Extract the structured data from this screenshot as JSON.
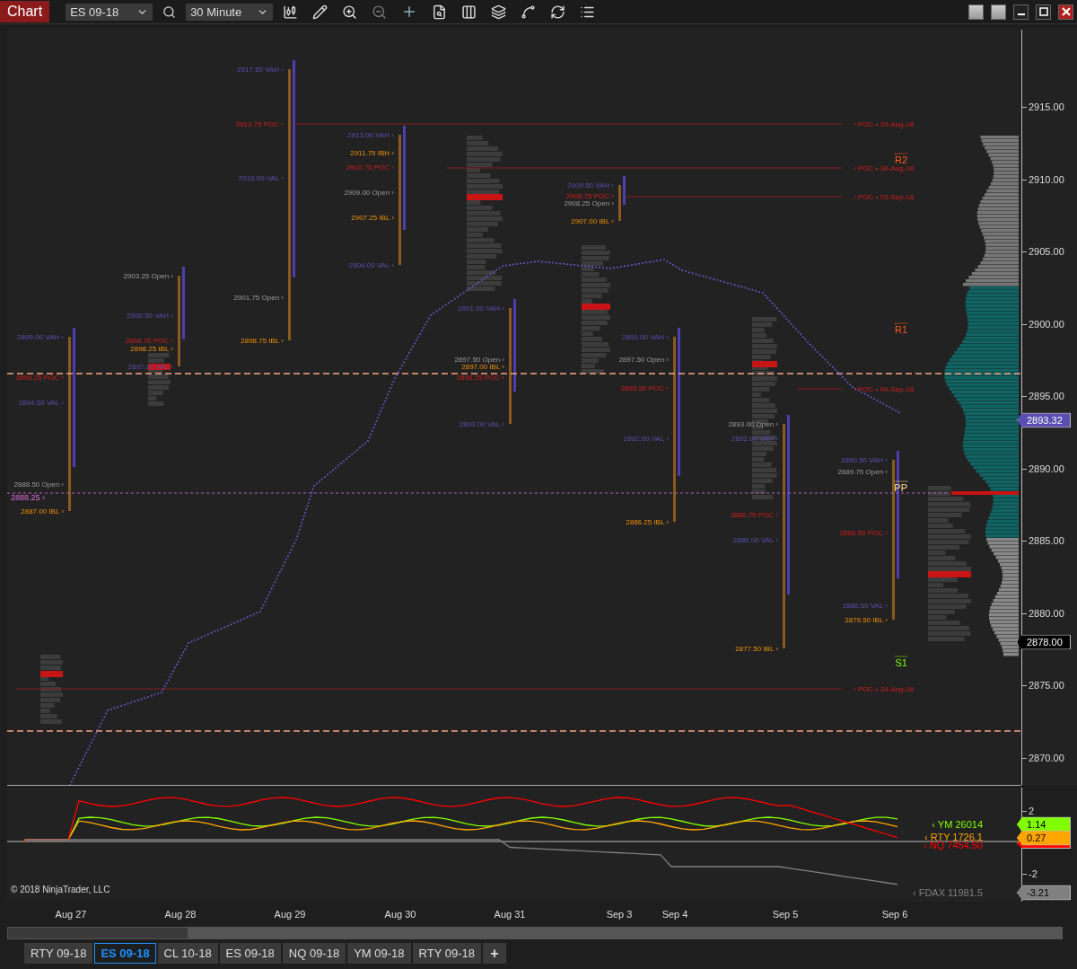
{
  "toolbar": {
    "title": "Chart",
    "instrument": "ES 09-18",
    "interval": "30 Minute"
  },
  "days": [
    {
      "date": "Aug 27",
      "levels": [
        {
          "text": "2899.00 VAH ›",
          "kind": "va"
        },
        {
          "text": "2896.25 POC ›",
          "kind": "poc"
        },
        {
          "text": "2894.50 VAL ›",
          "kind": "va"
        },
        {
          "text": "2888.50 Open ›",
          "kind": "open"
        },
        {
          "text": "2887.00 IBL ›",
          "kind": "ib"
        }
      ]
    },
    {
      "date": "Aug 28",
      "levels": [
        {
          "text": "2903.25 Open ›",
          "kind": "open"
        },
        {
          "text": "2900.50 VAH ›",
          "kind": "va"
        },
        {
          "text": "2898.75 POC ›",
          "kind": "poc"
        },
        {
          "text": "2898.25 IBL ›",
          "kind": "ib"
        },
        {
          "text": "2897.00 VAL ›",
          "kind": "va"
        }
      ]
    },
    {
      "date": "Aug 29",
      "levels": [
        {
          "text": "2917.50 VAH ›",
          "kind": "va"
        },
        {
          "text": "2913.75 POC ›",
          "kind": "poc"
        },
        {
          "text": "2910.00 VAL ›",
          "kind": "va"
        },
        {
          "text": "2901.75 Open ›",
          "kind": "open"
        },
        {
          "text": "2898.75 IBL ›",
          "kind": "ib"
        }
      ]
    },
    {
      "date": "Aug 30",
      "levels": [
        {
          "text": "2913.00 VAH ›",
          "kind": "va"
        },
        {
          "text": "2911.75 IBH ›",
          "kind": "ib"
        },
        {
          "text": "2910.75 POC ›",
          "kind": "poc"
        },
        {
          "text": "2909.00 Open ›",
          "kind": "open"
        },
        {
          "text": "2907.25 IBL ›",
          "kind": "ib"
        },
        {
          "text": "2904.00 VAL ›",
          "kind": "va"
        }
      ]
    },
    {
      "date": "Aug 31",
      "levels": [
        {
          "text": "2901.00 VAH ›",
          "kind": "va"
        },
        {
          "text": "2897.50 Open ›",
          "kind": "open"
        },
        {
          "text": "2897.00 IBL ›",
          "kind": "ib"
        },
        {
          "text": "2896.25 POC ›",
          "kind": "poc"
        },
        {
          "text": "2893.00 VAL ›",
          "kind": "va"
        }
      ]
    },
    {
      "date": "Sep 3",
      "levels": [
        {
          "text": "2909.50 VAH ›",
          "kind": "va"
        },
        {
          "text": "2908.75 POC ›",
          "kind": "poc"
        },
        {
          "text": "2908.25 Open ›",
          "kind": "open"
        },
        {
          "text": "2907.00 IBL ›",
          "kind": "ib"
        }
      ]
    },
    {
      "date": "Sep 4",
      "levels": [
        {
          "text": "2899.00 VAH ›",
          "kind": "va"
        },
        {
          "text": "2897.50 Open ›",
          "kind": "open"
        },
        {
          "text": "2895.50 POC ›",
          "kind": "poc"
        },
        {
          "text": "2892.00 VAL ›",
          "kind": "va"
        },
        {
          "text": "2886.25 IBL ›",
          "kind": "ib"
        }
      ]
    },
    {
      "date": "Sep 5",
      "levels": [
        {
          "text": "2893.00 Open ›",
          "kind": "open"
        },
        {
          "text": "2892.00 VAH ›",
          "kind": "va"
        },
        {
          "text": "2886.75 POC ›",
          "kind": "poc"
        },
        {
          "text": "2885.00 VAL ›",
          "kind": "va"
        },
        {
          "text": "2877.50 IBL ›",
          "kind": "ib"
        }
      ]
    },
    {
      "date": "Sep 6",
      "levels": [
        {
          "text": "2890.50 VAH ›",
          "kind": "va"
        },
        {
          "text": "2889.75 Open ›",
          "kind": "open"
        },
        {
          "text": "2885.50 POC ›",
          "kind": "poc"
        },
        {
          "text": "2880.50 VAL ›",
          "kind": "va"
        },
        {
          "text": "2879.50 IBL ›",
          "kind": "ib"
        }
      ]
    }
  ],
  "naked_pocs": [
    "‹ POC • 29-Aug-18",
    "‹ POC • 30-Aug-18",
    "‹ POC • 03-Sep-18",
    "‹ POC • 04-Sep-18",
    "‹ POC • 24-Aug-18"
  ],
  "pivots": [
    {
      "label": "R2",
      "kind": "resistance"
    },
    {
      "label": "R1",
      "kind": "resistance"
    },
    {
      "label": "PP",
      "kind": "pivot"
    },
    {
      "label": "S1",
      "kind": "support"
    }
  ],
  "pp_line": {
    "label": "2888.25 ›"
  },
  "price_axis": [
    "2915.00",
    "2910.00",
    "2905.00",
    "2900.00",
    "2895.00",
    "2890.00",
    "2885.00",
    "2880.00",
    "2875.00",
    "2870.00"
  ],
  "price_tags": [
    {
      "text": "2893.32",
      "kind": "vwap"
    },
    {
      "text": "2878.00",
      "kind": "last"
    }
  ],
  "copyright": "© 2018 NinjaTrader, LLC",
  "indicator": {
    "axis": [
      "2",
      "-2"
    ],
    "series": [
      {
        "label": "‹ YM 26014",
        "color": "#80ff00",
        "tag": "1.14"
      },
      {
        "label": "‹ RTY 1726.1",
        "color": "#ffa500",
        "tag": "0.27"
      },
      {
        "label": "‹ NQ 7454.50",
        "color": "#ff0000"
      },
      {
        "label": "‹ FDAX 11981.5",
        "color": "#808080",
        "tag": "-3.21"
      }
    ]
  },
  "tabs": [
    {
      "label": "RTY 09-18",
      "selected": false
    },
    {
      "label": "ES 09-18",
      "selected": true
    },
    {
      "label": "CL 10-18",
      "selected": false
    },
    {
      "label": "ES 09-18",
      "selected": false
    },
    {
      "label": "NQ 09-18",
      "selected": false
    },
    {
      "label": "YM 09-18",
      "selected": false
    },
    {
      "label": "RTY 09-18",
      "selected": false
    }
  ],
  "add_tab": "+"
}
